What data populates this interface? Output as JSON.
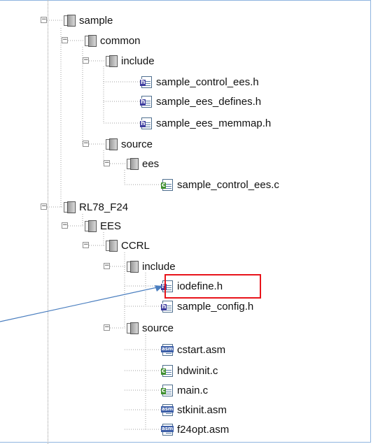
{
  "tree": {
    "items": [
      {
        "label": "sample",
        "type": "folder",
        "icon": "folder-icon",
        "expanded": true
      },
      {
        "label": "common",
        "type": "folder",
        "icon": "folder-icon",
        "expanded": true
      },
      {
        "label": "include",
        "type": "folder",
        "icon": "folder-icon",
        "expanded": true
      },
      {
        "label": "sample_control_ees.h",
        "type": "h",
        "icon": "header-file-icon"
      },
      {
        "label": "sample_ees_defines.h",
        "type": "h",
        "icon": "header-file-icon"
      },
      {
        "label": "sample_ees_memmap.h",
        "type": "h",
        "icon": "header-file-icon"
      },
      {
        "label": "source",
        "type": "folder",
        "icon": "folder-icon",
        "expanded": true
      },
      {
        "label": "ees",
        "type": "folder",
        "icon": "folder-icon",
        "expanded": true
      },
      {
        "label": "sample_control_ees.c",
        "type": "c",
        "icon": "c-file-icon"
      },
      {
        "label": "RL78_F24",
        "type": "folder",
        "icon": "folder-icon",
        "expanded": true
      },
      {
        "label": "EES",
        "type": "folder",
        "icon": "folder-icon",
        "expanded": true
      },
      {
        "label": "CCRL",
        "type": "folder",
        "icon": "folder-icon",
        "expanded": true
      },
      {
        "label": "include",
        "type": "folder",
        "icon": "folder-icon",
        "expanded": true
      },
      {
        "label": "iodefine.h",
        "type": "h",
        "icon": "header-file-icon",
        "highlighted": true
      },
      {
        "label": "sample_config.h",
        "type": "h",
        "icon": "header-file-icon"
      },
      {
        "label": "source",
        "type": "folder",
        "icon": "folder-icon",
        "expanded": true
      },
      {
        "label": "cstart.asm",
        "type": "asm",
        "icon": "asm-file-icon"
      },
      {
        "label": "hdwinit.c",
        "type": "c",
        "icon": "c-file-icon"
      },
      {
        "label": "main.c",
        "type": "c",
        "icon": "c-file-icon"
      },
      {
        "label": "stkinit.asm",
        "type": "asm",
        "icon": "asm-file-icon"
      },
      {
        "label": "f24opt.asm",
        "type": "asm",
        "icon": "asm-file-icon"
      }
    ]
  },
  "glyphs": {
    "collapse": "−",
    "h": "h",
    "c": "c",
    "asm": "asm"
  },
  "colors": {
    "highlight_box": "#e8141b",
    "arrow": "#4a7ebf",
    "frame_border": "#8eb4df"
  }
}
